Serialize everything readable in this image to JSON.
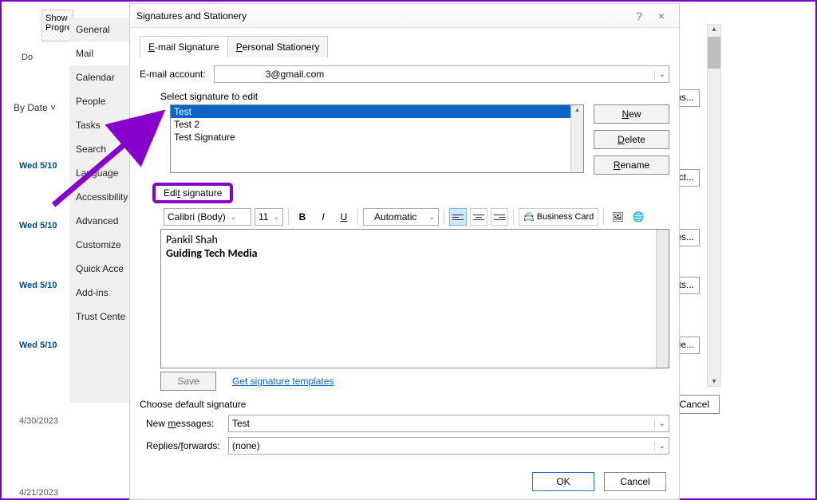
{
  "ribbon": {
    "show_progress": "Show\nProgre",
    "do_label": "Do"
  },
  "bydate": "By Date",
  "mail_dates": [
    "Wed 5/10",
    "Wed 5/10",
    "Wed 5/10",
    "Wed 5/10",
    "4/30/2023",
    "4/21/2023"
  ],
  "bg_buttons": [
    "ns...",
    "ct...",
    "es...",
    "its...",
    "ie..."
  ],
  "bg_cancel": "Cancel",
  "categories": {
    "items": [
      "General",
      "Mail",
      "Calendar",
      "People",
      "Tasks",
      "Search",
      "Language",
      "Accessibility",
      "Advanced",
      "Customize",
      "Quick Acce",
      "Add-ins",
      "Trust Cente"
    ],
    "selected_index": 1
  },
  "dialog": {
    "title": "Signatures and Stationery",
    "help": "?",
    "close": "×",
    "tabs": {
      "email_sig": "E-mail Signature",
      "personal": "Personal Stationery",
      "e_underline": "E",
      "p_underline": "P"
    },
    "account_label": "E-mail account:",
    "account_value": "3@gmail.com",
    "select_label": "Select signature to edit",
    "signatures": [
      "Test",
      "Test 2",
      "Test Signature"
    ],
    "sig_buttons": {
      "new": "New",
      "delete": "Delete",
      "rename": "Rename",
      "n": "N",
      "d": "D",
      "r": "R"
    },
    "edit_label": "Edit signature",
    "toolbar": {
      "font": "Calibri (Body)",
      "size": "11",
      "auto": "Automatic",
      "business": "Business Card"
    },
    "editor": {
      "line1": "Pankil Shah",
      "line2": "Guiding Tech Media"
    },
    "save": "Save",
    "templates_link": "Get signature templates",
    "default_label": "Choose default signature",
    "new_msgs_label": "New messages:",
    "new_msgs_value": "Test",
    "replies_label": "Replies/forwards:",
    "replies_value": "(none)",
    "ok": "OK",
    "cancel": "Cancel"
  }
}
